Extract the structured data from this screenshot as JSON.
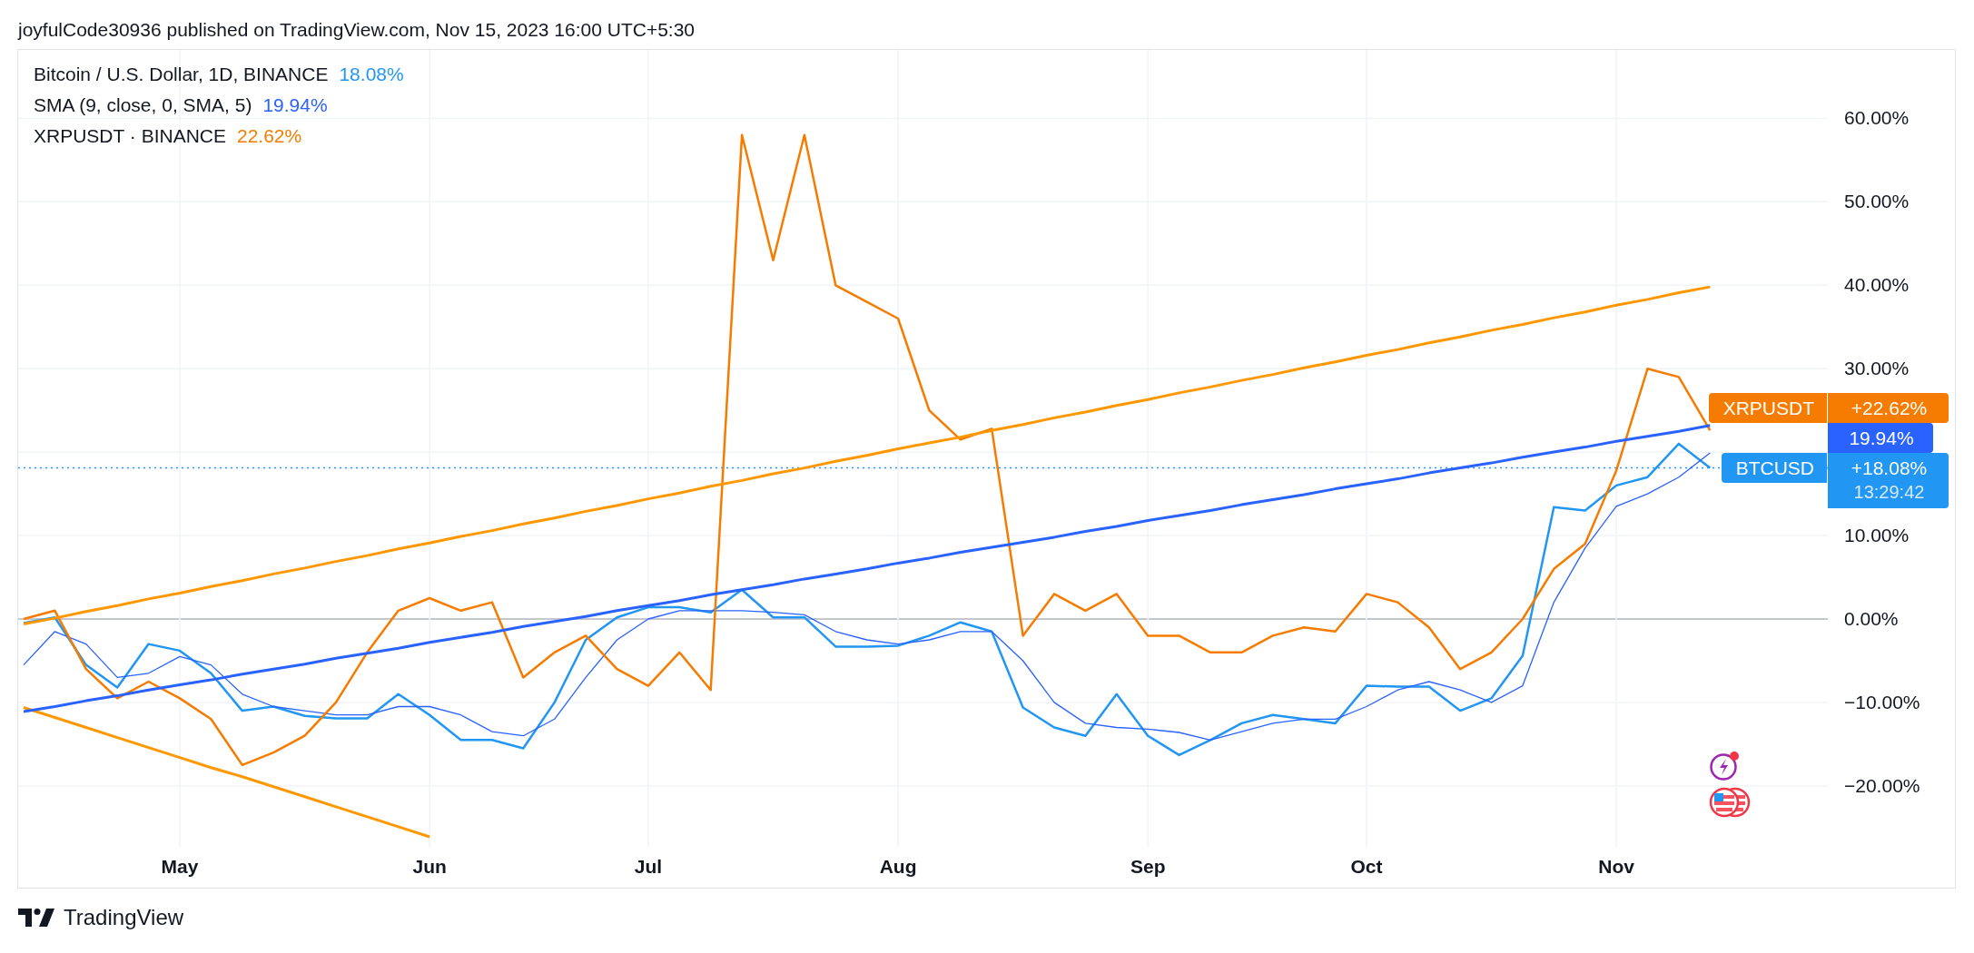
{
  "header": {
    "text": "joyfulCode30936 published on TradingView.com, Nov 15, 2023 16:00 UTC+5:30"
  },
  "legend": [
    {
      "label": "Bitcoin / U.S. Dollar, 1D, BINANCE",
      "value": "18.08%"
    },
    {
      "label": "SMA (9, close, 0, SMA, 5)",
      "value": "19.94%"
    },
    {
      "label": "XRPUSDT · BINANCE",
      "value": "22.62%"
    }
  ],
  "price_labels": [
    {
      "kind": "symbol",
      "name": "XRPUSDT",
      "value": "+22.62%",
      "color": "#f57c00"
    },
    {
      "kind": "plain",
      "value": "19.94%",
      "color": "#2962ff"
    },
    {
      "kind": "symbol",
      "name": "BTCUSD",
      "value": "+18.08%",
      "countdown": "13:29:42",
      "color": "#2196f3"
    }
  ],
  "chart": {
    "chart_data": {
      "type": "line",
      "categories": [
        null,
        null,
        null,
        null,
        null,
        "May",
        null,
        null,
        null,
        null,
        null,
        null,
        null,
        "Jun",
        null,
        null,
        null,
        null,
        null,
        null,
        "Jul",
        null,
        null,
        null,
        null,
        null,
        null,
        null,
        "Aug",
        null,
        null,
        null,
        null,
        null,
        null,
        null,
        "Sep",
        null,
        null,
        null,
        null,
        null,
        null,
        "Oct",
        null,
        null,
        null,
        null,
        null,
        null,
        null,
        "Nov",
        null,
        null,
        null
      ],
      "ylim": [
        -27.3,
        68.2
      ],
      "grid": true,
      "ref_lines": [
        {
          "axis": "y",
          "value": 18.1,
          "color": "#2196f3"
        }
      ],
      "yticks": [
        {
          "value": 60,
          "label": "60.00%"
        },
        {
          "value": 50,
          "label": "50.00%"
        },
        {
          "value": 40,
          "label": "40.00%"
        },
        {
          "value": 30,
          "label": "30.00%"
        },
        {
          "value": 10,
          "label": "10.00%"
        },
        {
          "value": 0,
          "label": "0.00%"
        },
        {
          "value": -10,
          "label": "−10.00%"
        },
        {
          "value": -20,
          "label": "−20.00%"
        }
      ],
      "series": [
        {
          "color": "#2196f3",
          "values": [
            -0.5,
            0.2,
            -5.5,
            -8.2,
            -3,
            -3.8,
            -6.5,
            -11,
            -10.5,
            -11.6,
            -11.9,
            -11.9,
            -9,
            -11.5,
            -14.5,
            -14.5,
            -15.5,
            -10,
            -2.5,
            0.2,
            1.4,
            1.4,
            0.8,
            3.5,
            0.2,
            0.2,
            -3.3,
            -3.3,
            -3.2,
            -2,
            -0.4,
            -1.5,
            -10.6,
            -13,
            -14,
            -9,
            -14,
            -16.3,
            -14.5,
            -12.5,
            -11.5,
            -12,
            -12.5,
            -8,
            -8.1,
            -8.1,
            -11,
            -9.5,
            -4.4,
            13.4,
            13,
            16,
            17,
            21,
            18.1
          ]
        },
        {
          "color": "#2962ff",
          "values": [
            -5.5,
            -1.5,
            -3,
            -7,
            -6.5,
            -4.5,
            -5.5,
            -9,
            -10.5,
            -11,
            -11.5,
            -11.5,
            -10.5,
            -10.5,
            -11.5,
            -13.5,
            -14,
            -12,
            -7,
            -2.5,
            0,
            1,
            1,
            1,
            0.8,
            0.5,
            -1.5,
            -2.5,
            -3,
            -2.5,
            -1.5,
            -1.5,
            -5,
            -10,
            -12.5,
            -13,
            -13.2,
            -13.6,
            -14.5,
            -13.5,
            -12.5,
            -12,
            -12,
            -10.5,
            -8.5,
            -7.5,
            -8.5,
            -10,
            -8,
            2,
            8.5,
            13.5,
            15,
            17,
            19.9
          ]
        },
        {
          "color": "#f57c00",
          "values": [
            0,
            1,
            -6,
            -9.5,
            -7.5,
            -9.5,
            -12,
            -17.5,
            -16,
            -14,
            -10,
            -4,
            1,
            2.5,
            1,
            2,
            -7,
            -4,
            -2,
            -6,
            -8,
            -4,
            -8.5,
            58,
            43,
            58,
            40,
            38,
            36,
            25,
            21.5,
            22.8,
            -2,
            3,
            1,
            3,
            -2,
            -2,
            -4,
            -4,
            -2,
            -1,
            -1.5,
            3,
            2,
            -1,
            -6,
            -4,
            0,
            6,
            9,
            17.8,
            30,
            29,
            22.6
          ]
        },
        {
          "color": "#ff9800",
          "values": [
            -0.6,
            0.1,
            0.9,
            1.6,
            2.4,
            3.1,
            3.9,
            4.6,
            5.4,
            6.1,
            6.9,
            7.6,
            8.4,
            9.1,
            9.9,
            10.6,
            11.4,
            12.1,
            12.9,
            13.6,
            14.4,
            15.1,
            15.9,
            16.6,
            17.4,
            18.1,
            18.9,
            19.6,
            20.4,
            21.1,
            21.8,
            22.6,
            23.3,
            24.1,
            24.8,
            25.6,
            26.3,
            27.1,
            27.8,
            28.6,
            29.3,
            30.1,
            30.8,
            31.6,
            32.3,
            33.1,
            33.8,
            34.6,
            35.3,
            36.1,
            36.8,
            37.6,
            38.3,
            39.1,
            39.8
          ]
        },
        {
          "color": "#ff9800",
          "values": [
            -10.6,
            -11.8,
            -13.0,
            -14.2,
            -15.4,
            -16.6,
            -17.8,
            -18.9,
            -20.1,
            -21.3,
            -22.5,
            -23.7,
            -24.9,
            -26.1,
            null,
            null,
            null,
            null,
            null,
            null,
            null,
            null,
            null,
            null,
            null,
            null,
            null,
            null,
            null,
            null,
            null,
            null,
            null,
            null,
            null,
            null,
            null,
            null,
            null,
            null,
            null,
            null,
            null,
            null,
            null,
            null,
            null,
            null,
            null,
            null,
            null,
            null,
            null,
            null,
            null
          ]
        },
        {
          "color": "#2962ff",
          "values": [
            -11.1,
            -10.5,
            -9.8,
            -9.2,
            -8.5,
            -7.9,
            -7.3,
            -6.6,
            -6.0,
            -5.4,
            -4.7,
            -4.1,
            -3.5,
            -2.8,
            -2.2,
            -1.6,
            -0.9,
            -0.3,
            0.3,
            1.0,
            1.6,
            2.2,
            2.9,
            3.5,
            4.1,
            4.8,
            5.4,
            6.0,
            6.7,
            7.3,
            8.0,
            8.6,
            9.2,
            9.8,
            10.5,
            11.1,
            11.8,
            12.4,
            13.0,
            13.7,
            14.3,
            14.9,
            15.6,
            16.2,
            16.8,
            17.5,
            18.1,
            18.7,
            19.4,
            20.0,
            20.6,
            21.3,
            21.9,
            22.5,
            23.2
          ]
        }
      ]
    }
  },
  "footer": {
    "brand": "TradingView"
  }
}
